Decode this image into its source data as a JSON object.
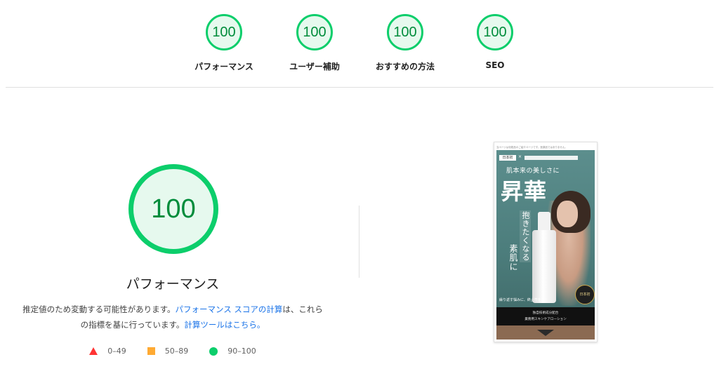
{
  "colors": {
    "pass": "#0cce6b",
    "pass_text": "#008c3b",
    "pass_bg": "#e6f9ee",
    "average": "#ffaa33",
    "fail": "#ff3333",
    "link": "#1a73e8"
  },
  "gauges": [
    {
      "score": "100",
      "label": "パフォーマンス"
    },
    {
      "score": "100",
      "label": "ユーザー補助"
    },
    {
      "score": "100",
      "label": "おすすめの方法"
    },
    {
      "score": "100",
      "label": "SEO"
    }
  ],
  "main": {
    "score": "100",
    "title": "パフォーマンス",
    "desc_text1": "推定値のため変動する可能性があります。",
    "desc_link1": "パフォーマンス スコアの計算",
    "desc_text2": "は、これらの指標を基に行っています。",
    "desc_link2": "計算ツールはこちら。"
  },
  "legend": [
    {
      "icon": "fail-triangle-icon",
      "range": "0–49"
    },
    {
      "icon": "average-square-icon",
      "range": "50–89"
    },
    {
      "icon": "pass-circle-icon",
      "range": "90–100"
    }
  ],
  "screenshot": {
    "top_text": "当ページは化粧品のご紹介ページです。医薬品ではありません。",
    "brand_box": "日本初",
    "cross": "×",
    "subheadline": "肌本来の美しさに",
    "headline": "昇華",
    "vertical_1": "抱きたくなる",
    "vertical_2": "素肌に",
    "badge": "日本初",
    "strap": "繰り返す悩みに、終止符を。",
    "dark_line1": "独自技術成分配合",
    "dark_line2": "業務用スキンケアローション"
  }
}
